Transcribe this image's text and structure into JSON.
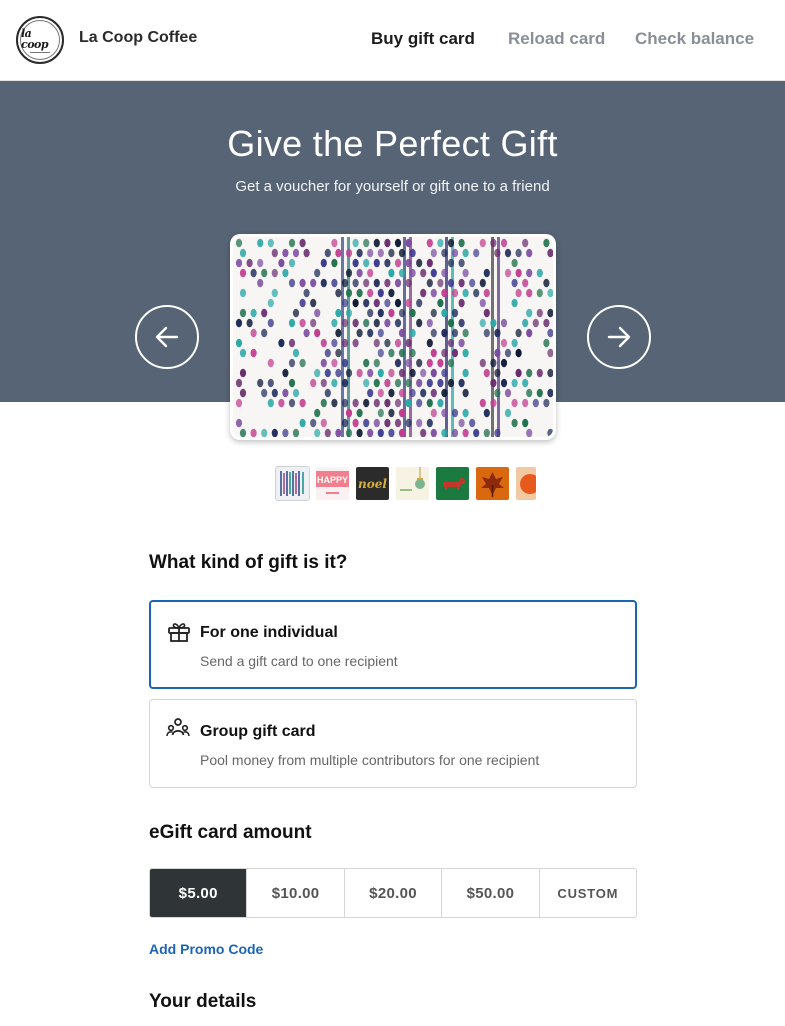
{
  "header": {
    "brand": "La Coop Coffee",
    "logo_text": "la coop",
    "nav": [
      {
        "label": "Buy gift card",
        "active": true
      },
      {
        "label": "Reload card",
        "active": false
      },
      {
        "label": "Check balance",
        "active": false
      }
    ]
  },
  "hero": {
    "title": "Give the Perfect Gift",
    "subtitle": "Get a voucher for yourself or gift one to a friend",
    "background": "#566476",
    "prev_icon": "arrow-left-icon",
    "next_icon": "arrow-right-icon"
  },
  "card_designs": [
    {
      "name": "woven-pattern",
      "selected": true
    },
    {
      "name": "happy-pink",
      "text": "HAPPY",
      "selected": false
    },
    {
      "name": "noel-gold",
      "text": "noel",
      "selected": false
    },
    {
      "name": "ornament-cream",
      "selected": false
    },
    {
      "name": "dachshund-green",
      "selected": false
    },
    {
      "name": "autumn-leaf",
      "selected": false
    },
    {
      "name": "orange-sun",
      "selected": false
    }
  ],
  "gift_kind": {
    "title": "What kind of gift is it?",
    "options": [
      {
        "title": "For one individual",
        "description": "Send a gift card to one recipient",
        "icon": "gift-icon",
        "selected": true
      },
      {
        "title": "Group gift card",
        "description": "Pool money from multiple contributors for one recipient",
        "icon": "group-icon",
        "selected": false
      }
    ]
  },
  "amount": {
    "title": "eGift card amount",
    "options": [
      "$5.00",
      "$10.00",
      "$20.00",
      "$50.00",
      "CUSTOM"
    ],
    "selected": "$5.00"
  },
  "promo_label": "Add Promo Code",
  "details_title": "Your details",
  "colors": {
    "accent": "#1c64b4",
    "selected_amount_bg": "#2f3437"
  }
}
